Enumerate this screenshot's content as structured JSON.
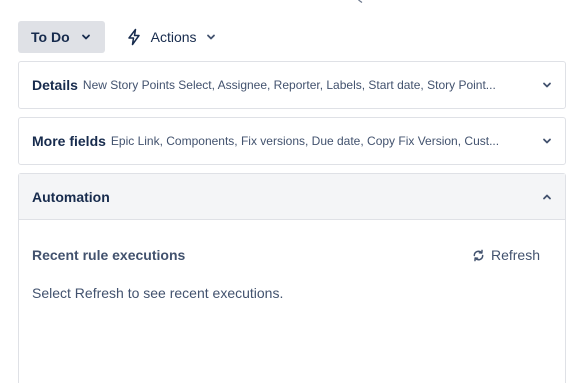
{
  "status": {
    "label": "To Do"
  },
  "actions": {
    "label": "Actions"
  },
  "details": {
    "title": "Details",
    "summary": "New Story Points Select, Assignee, Reporter, Labels, Start date, Story Point..."
  },
  "more_fields": {
    "title": "More fields",
    "summary": "Epic Link, Components, Fix versions, Due date, Copy Fix Version, Cust..."
  },
  "automation": {
    "title": "Automation",
    "recent_title": "Recent rule executions",
    "refresh_label": "Refresh",
    "hint": "Select Refresh to see recent executions."
  },
  "icons": {
    "status_chevron": "chevron-down-icon",
    "actions": "lightning-bolt-icon",
    "actions_chevron": "chevron-down-icon",
    "details_chevron": "chevron-down-icon",
    "more_chevron": "chevron-down-icon",
    "automation_chevron": "chevron-up-icon",
    "refresh": "refresh-icon"
  },
  "colors": {
    "status_bg": "#dfe1e6",
    "panel_border": "#dfe1e6",
    "automation_header_bg": "#f4f5f7",
    "text_primary": "#172b4d",
    "text_secondary": "#42526e"
  }
}
